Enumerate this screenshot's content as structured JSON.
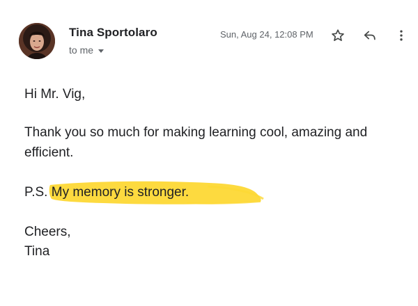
{
  "email": {
    "sender_name": "Tina Sportolaro",
    "recipient_label": "to me",
    "date": "Sun, Aug 24, 12:08 PM",
    "body": {
      "greeting": "Hi Mr. Vig,",
      "paragraph": "Thank you so much for making learning cool, amazing and efficient.",
      "ps_prefix": "P.S.",
      "ps_highlighted": "My memory is stronger.",
      "closing": "Cheers,",
      "signature": "Tina"
    }
  },
  "icons": {
    "avatar": "sender-avatar-photo",
    "star": "star-outline-icon",
    "reply": "reply-arrow-icon",
    "more": "more-vertical-icon",
    "recipient_caret": "caret-down-icon"
  },
  "colors": {
    "highlight": "#fdd835",
    "text_primary": "#202124",
    "text_secondary": "#5f6368"
  }
}
